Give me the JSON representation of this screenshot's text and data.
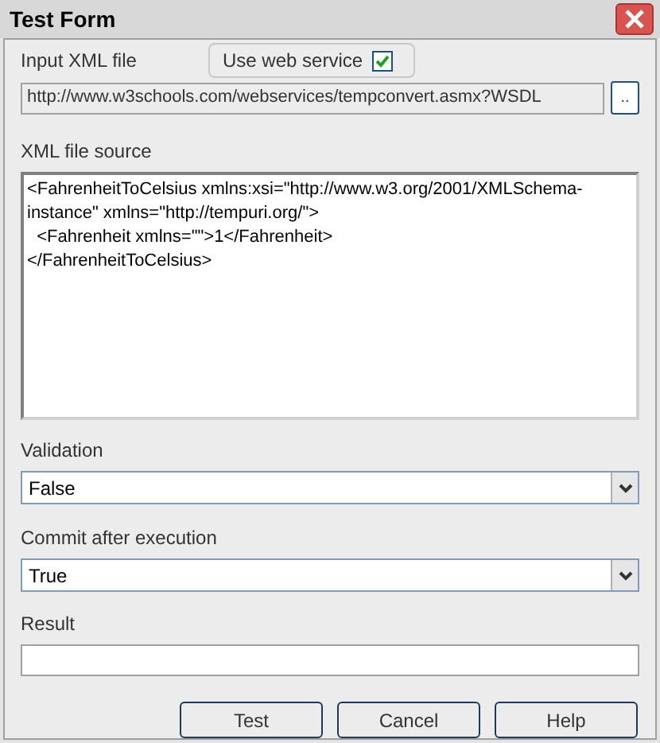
{
  "window": {
    "title": "Test Form"
  },
  "input_file": {
    "label": "Input XML file",
    "use_web_service": {
      "label": "Use web service",
      "checked": true
    },
    "value": "http://www.w3schools.com/webservices/tempconvert.asmx?WSDL",
    "browse_button": ".."
  },
  "source": {
    "label": "XML file source",
    "lines": [
      "<FahrenheitToCelsius xmlns:xsi=\"http://www.w3.org/2001/XMLSchema-",
      "instance\" xmlns=\"http://tempuri.org/\">",
      "  <Fahrenheit xmlns=\"\">1</Fahrenheit>",
      "</FahrenheitToCelsius>"
    ]
  },
  "validation": {
    "label": "Validation",
    "value": "False"
  },
  "commit": {
    "label": "Commit after execution",
    "value": "True"
  },
  "result": {
    "label": "Result"
  },
  "buttons": [
    "Test",
    "Cancel",
    "Help"
  ]
}
